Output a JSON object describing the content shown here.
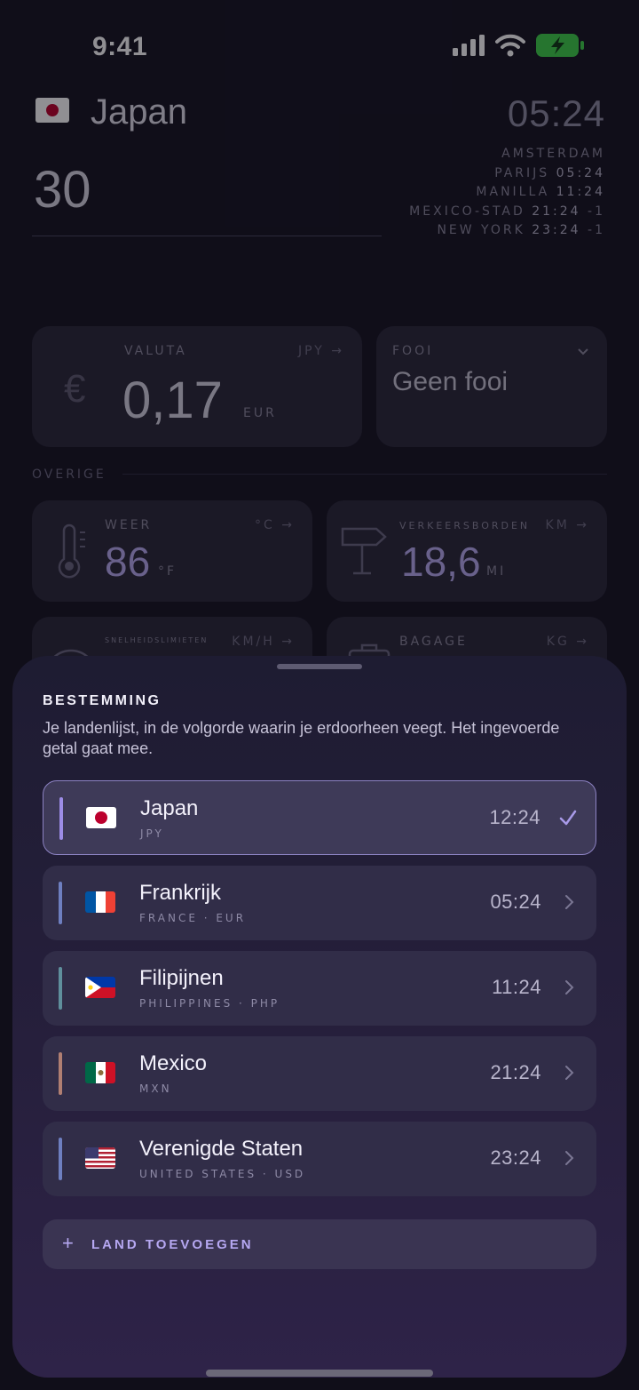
{
  "status_bar": {
    "time": "9:41"
  },
  "header": {
    "country": "Japan",
    "amount": "30",
    "clock": "05:24",
    "timezones": [
      {
        "city": "AMSTERDAM",
        "time": "",
        "offset": ""
      },
      {
        "city": "PARIJS",
        "time": "05:24",
        "offset": ""
      },
      {
        "city": "MANILLA",
        "time": "11:24",
        "offset": ""
      },
      {
        "city": "MEXICO-STAD",
        "time": "21:24",
        "offset": "-1"
      },
      {
        "city": "NEW YORK",
        "time": "23:24",
        "offset": "-1"
      }
    ]
  },
  "currency_card": {
    "label": "VALUTA",
    "unit": "JPY",
    "value": "0,17",
    "value_unit": "EUR",
    "symbol": "€"
  },
  "tip_card": {
    "label": "FOOI",
    "value": "Geen fooi"
  },
  "other_section": {
    "label": "OVERIGE"
  },
  "weather_card": {
    "label": "WEER",
    "unit": "°C",
    "value": "86",
    "value_unit": "°F"
  },
  "signs_card": {
    "label": "VERKEERSBORDEN",
    "unit": "KM",
    "value": "18,6",
    "value_unit": "MI"
  },
  "speed_card": {
    "label": "SNELHEIDSLIMIETEN",
    "unit": "KM/H"
  },
  "luggage_card": {
    "label": "BAGAGE",
    "unit": "KG"
  },
  "sheet": {
    "title": "BESTEMMING",
    "description": "Je landenlijst, in de volgorde waarin je erdoorheen veegt. Het ingevoerde getal gaat mee.",
    "countries": [
      {
        "name": "Japan",
        "sub": "JPY",
        "time": "12:24",
        "selected": true,
        "accent": "#9c8ce6",
        "flag": "japan-flag-icon"
      },
      {
        "name": "Frankrijk",
        "sub": "FRANCE · EUR",
        "time": "05:24",
        "selected": false,
        "accent": "#6e7fc0",
        "flag": "france-flag-icon"
      },
      {
        "name": "Filipijnen",
        "sub": "PHILIPPINES · PHP",
        "time": "11:24",
        "selected": false,
        "accent": "#5f8f9c",
        "flag": "philippines-flag-icon"
      },
      {
        "name": "Mexico",
        "sub": "MXN",
        "time": "21:24",
        "selected": false,
        "accent": "#b07f72",
        "flag": "mexico-flag-icon"
      },
      {
        "name": "Verenigde Staten",
        "sub": "UNITED STATES · USD",
        "time": "23:24",
        "selected": false,
        "accent": "#6e7fc0",
        "flag": "usa-flag-icon"
      }
    ],
    "add_label": "LAND TOEVOEGEN"
  }
}
